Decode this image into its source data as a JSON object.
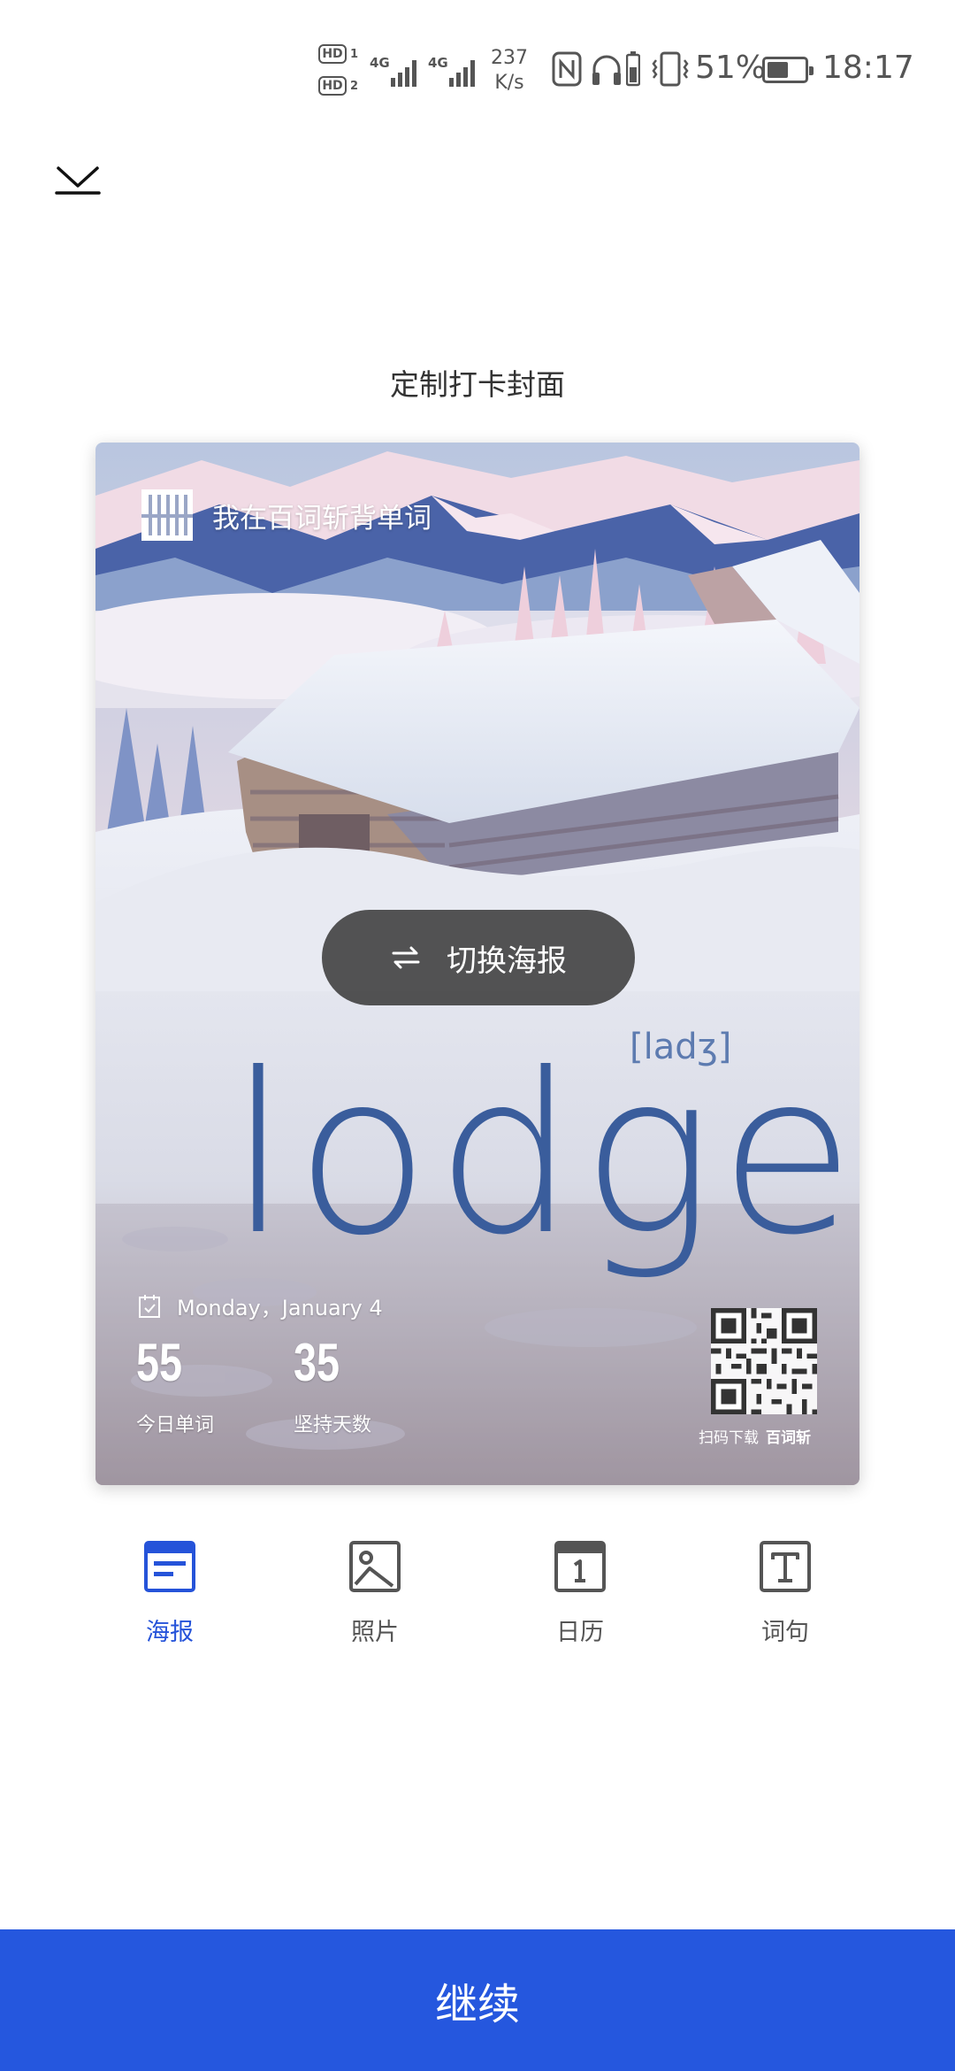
{
  "status_bar": {
    "hd1": "HD",
    "hd1_sub": "1",
    "hd2": "HD",
    "hd2_sub": "2",
    "net1": "4G",
    "net2": "4G",
    "speed_value": "237",
    "speed_unit": "K/s",
    "battery_percent": "51%",
    "battery_level": 0.51,
    "time": "18:17",
    "icons": [
      "nfc-icon",
      "headphones-icon",
      "battery-small-icon",
      "vibrate-icon",
      "battery-icon"
    ]
  },
  "header": {
    "collapse_icon": "chevron-down-icon",
    "title": "定制打卡封面"
  },
  "poster": {
    "brand_text": "我在百词斩背单词",
    "switch_label": "切换海报",
    "phonetic": "[ladʒ]",
    "word": "lodge",
    "date": "Monday，January 4",
    "stats": [
      {
        "value": "55",
        "label": "今日单词"
      },
      {
        "value": "35",
        "label": "坚持天数"
      }
    ],
    "qr_caption": "扫码下载",
    "qr_brand": "百词斩"
  },
  "tabs": [
    {
      "label": "海报",
      "icon": "poster-icon",
      "active": true
    },
    {
      "label": "照片",
      "icon": "photo-icon",
      "active": false
    },
    {
      "label": "日历",
      "icon": "calendar-icon",
      "active": false
    },
    {
      "label": "词句",
      "icon": "text-icon",
      "active": false
    }
  ],
  "footer": {
    "continue_label": "继续"
  },
  "colors": {
    "accent": "#2557de",
    "active_tab": "#2553d9",
    "word": "#3a5d9c"
  }
}
